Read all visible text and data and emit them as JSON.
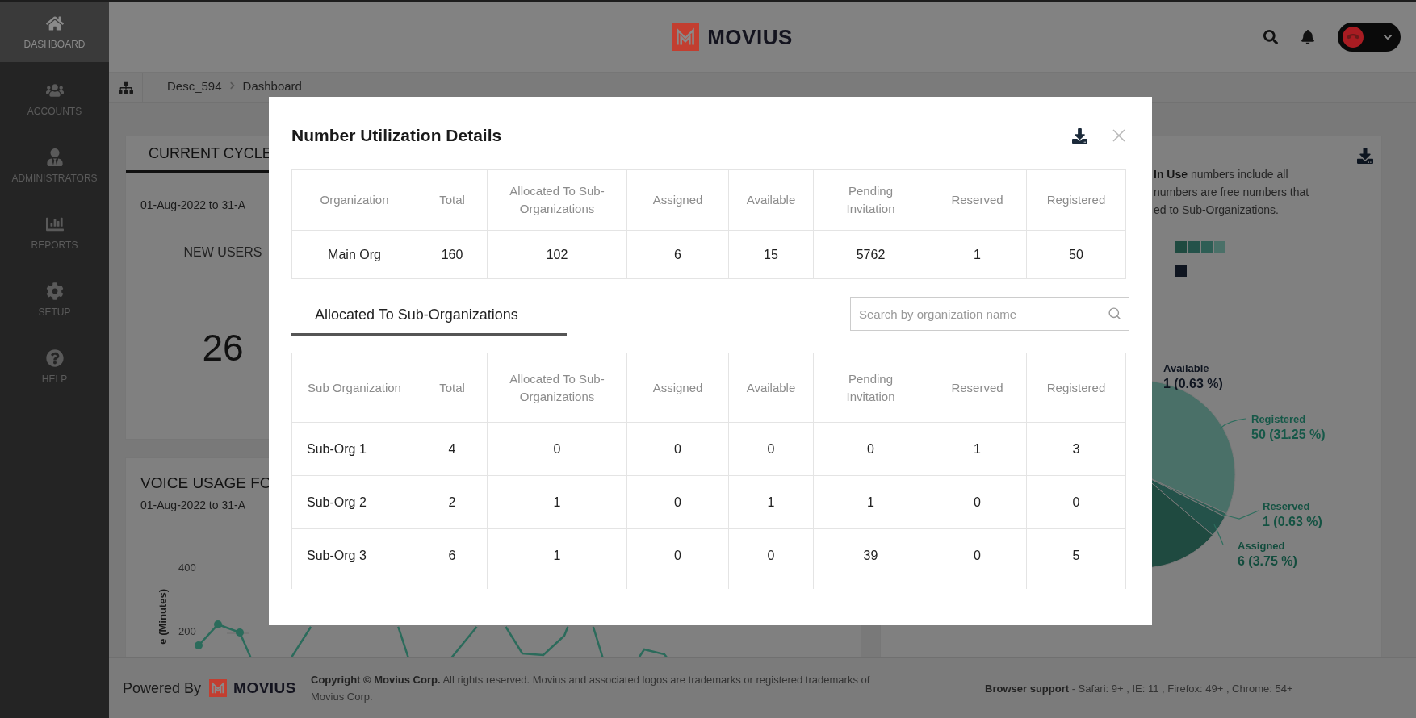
{
  "sidebar": {
    "items": [
      {
        "label": "DASHBOARD",
        "selected": true
      },
      {
        "label": "ACCOUNTS",
        "selected": false
      },
      {
        "label": "ADMINISTRATORS",
        "selected": false
      },
      {
        "label": "REPORTS",
        "selected": false
      },
      {
        "label": "SETUP",
        "selected": false
      },
      {
        "label": "HELP",
        "selected": false
      }
    ]
  },
  "header": {
    "logo": "MOVIUS"
  },
  "breadcrumb": {
    "items": [
      "Desc_594",
      "Dashboard"
    ]
  },
  "current_cycle_card": {
    "tab": "CURRENT CYCLE",
    "date_range": "01-Aug-2022 to 31-A",
    "metric_label": "NEW USERS",
    "metric_value": "26"
  },
  "voice_usage_card": {
    "title": "VOICE USAGE FO",
    "date_range": "01-Aug-2022 to 31-A",
    "y_axis_title": "e (Minutes)",
    "y_ticks": [
      "400",
      "200"
    ]
  },
  "utilization_card": {
    "note_lines": [
      "**In Use** numbers include all",
      "numbers are free numbers that",
      "ed to Sub-Organizations."
    ],
    "legend": [
      {
        "color": "#1f4a40"
      },
      {
        "color": "#24524a"
      },
      {
        "color": "#2e5e55"
      },
      {
        "color": "#4a7068"
      },
      {
        "color": "#0f1520"
      }
    ],
    "pie_labels": [
      {
        "name": "Available",
        "reading": "1 (0.63 %)",
        "color": "#0f1520"
      },
      {
        "name": "Registered",
        "reading": "50 (31.25 %)",
        "color": "#165848"
      },
      {
        "name": "Reserved",
        "reading": "1 (0.63 %)",
        "color": "#145242"
      },
      {
        "name": "Assigned",
        "reading": "6 (3.75 %)",
        "color": "#124c3d"
      }
    ]
  },
  "modal": {
    "title": "Number Utilization Details",
    "summary_table": {
      "columns": [
        "Organization",
        "Total",
        "Allocated To Sub-Organizations",
        "Assigned",
        "Available",
        "Pending Invitation",
        "Reserved",
        "Registered"
      ],
      "rows": [
        [
          "Main Org",
          "160",
          "102",
          "6",
          "15",
          "5762",
          "1",
          "50"
        ]
      ]
    },
    "tabs": [
      {
        "label": "Allocated To Sub-Organizations",
        "selected": true
      }
    ],
    "search": {
      "placeholder": "Search by organization name"
    },
    "sub_table": {
      "columns": [
        "Sub Organization",
        "Total",
        "Allocated To Sub-Organizations",
        "Assigned",
        "Available",
        "Pending Invitation",
        "Reserved",
        "Registered"
      ],
      "rows": [
        [
          "Sub-Org 1",
          "4",
          "0",
          "0",
          "0",
          "0",
          "1",
          "3"
        ],
        [
          "Sub-Org 2",
          "2",
          "1",
          "0",
          "1",
          "1",
          "0",
          "0"
        ],
        [
          "Sub-Org 3",
          "6",
          "1",
          "0",
          "0",
          "39",
          "0",
          "5"
        ]
      ]
    }
  },
  "footer": {
    "powered_by": "Powered By",
    "logo": "MOVIUS",
    "copyright": "**Copyright © Movius Corp.** All rights reserved. Movius and associated logos are trademarks or registered trademarks of Movius Corp.",
    "browser_support": "**Browser support** - Safari: 9+ , IE: 11 , Firefox: 49+ , Chrome: 54+"
  }
}
